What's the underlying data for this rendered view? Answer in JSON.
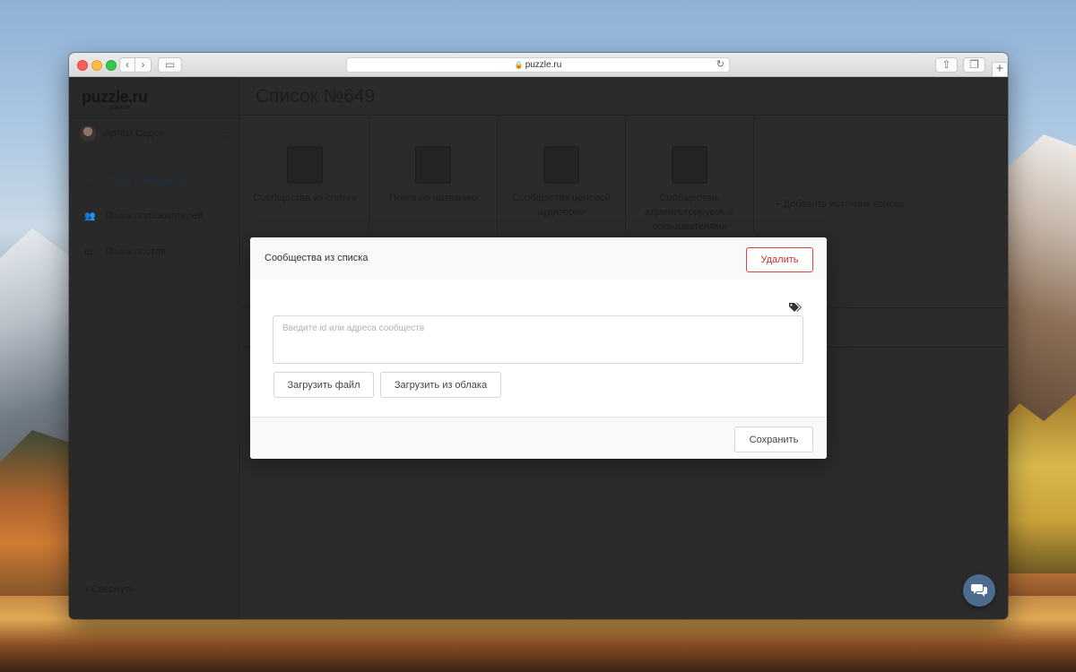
{
  "browser": {
    "url": "puzzle.ru",
    "back_glyph": "‹",
    "forward_glyph": "›",
    "sidebar_glyph": "▭",
    "share_glyph": "⇧",
    "tabs_glyph": "❐",
    "newtab_glyph": "+",
    "lock_glyph": "🔒",
    "reload_glyph": "↻"
  },
  "app": {
    "logo": "puzzle.ru",
    "logo_sub": "parser",
    "user": {
      "name": "Артём Седов",
      "menu_glyph": "⋮"
    },
    "nav": [
      {
        "label": "Поиск  сообществ",
        "icon": "chat-icon",
        "glyph": "●",
        "active": true
      },
      {
        "label": "Поиск  пользователей",
        "icon": "users-icon",
        "glyph": "👥",
        "active": false
      },
      {
        "label": "Поиск  постов",
        "icon": "post-icon",
        "glyph": "▤",
        "active": false
      }
    ],
    "collapse": {
      "glyph": "‹",
      "label": "Свернуть"
    },
    "page_title": "Список №649",
    "sources": [
      {
        "label": "Сообщества из списка",
        "icon": "clipboard-list-icon"
      },
      {
        "label": "Поиск по названию",
        "icon": "document-search-icon"
      },
      {
        "label": "Сообщества целевой аудитории",
        "icon": "audience-icon"
      },
      {
        "label": "Сообщества, администрируемые пользователями",
        "icon": "admin-document-icon"
      }
    ],
    "add_source": {
      "glyph": "+",
      "label": "Добавить источник поиска"
    }
  },
  "modal": {
    "title": "Сообщества из списка",
    "delete_label": "Удалить",
    "input_placeholder": "Введите id или адреса сообществ",
    "input_value": "",
    "upload_file_label": "Загрузить файл",
    "upload_cloud_label": "Загрузить из облака",
    "save_label": "Сохранить"
  },
  "colors": {
    "accent": "#4d6b8f",
    "danger": "#c8352d"
  }
}
